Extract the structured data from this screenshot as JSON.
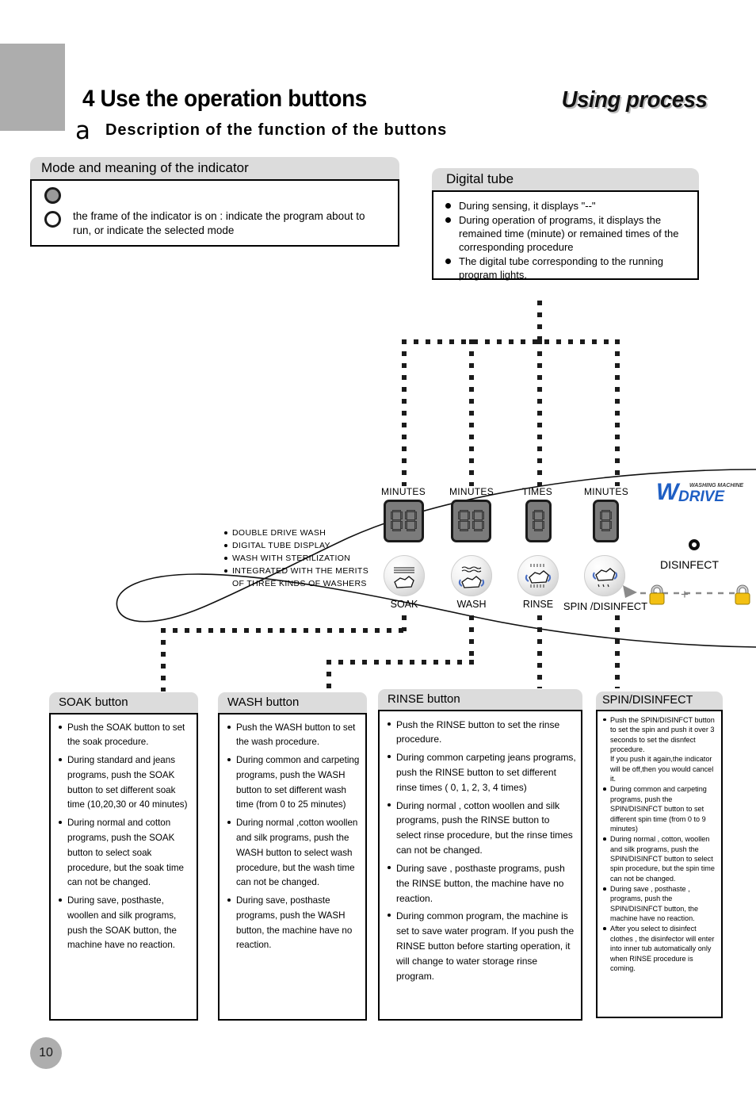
{
  "header": {
    "section_number_title": "4 Use the operation buttons",
    "using_process": "Using process",
    "subsection_letter": "a",
    "subsection_title": "Description of the function of the buttons"
  },
  "mode_panel": {
    "title": "Mode and meaning of the indicator",
    "indicator_filled_note": "",
    "indicator_hollow_note": "the frame of the indicator is on : indicate the program about to run, or indicate the selected mode"
  },
  "digital_tube_panel": {
    "title": "Digital tube",
    "items": [
      "During sensing, it displays \"--\"",
      "During operation of programs, it displays the remained time (minute) or remained times of the corresponding procedure",
      "The digital tube corresponding to the running program lights."
    ]
  },
  "control_panel": {
    "displays": [
      {
        "unit": "MINUTES",
        "digits": 2,
        "value": "88"
      },
      {
        "unit": "MINUTES",
        "digits": 2,
        "value": "88"
      },
      {
        "unit": "TIMES",
        "digits": 1,
        "value": "8"
      },
      {
        "unit": "MINUTES",
        "digits": 1,
        "value": "8"
      }
    ],
    "buttons": [
      {
        "label": "SOAK",
        "icon": "garment-soak-icon"
      },
      {
        "label": "WASH",
        "icon": "garment-wash-icon"
      },
      {
        "label": "RINSE",
        "icon": "garment-rinse-icon"
      },
      {
        "label": "SPIN /DISINFECT",
        "icon": "garment-spin-icon"
      }
    ],
    "features": [
      "DOUBLE DRIVE WASH",
      "DIGITAL TUBE DISPLAY",
      "WASH WITH STERILIZATION",
      "INTEGRATED WITH THE MERITS",
      "OF THREE KINDS OF WASHERS"
    ],
    "disinfect_led_label": "DISINFECT",
    "logo": {
      "top_text": "WASHING MACHINE",
      "main_text": "DRIVE",
      "mark": "W",
      "color": "#1f5fc4"
    },
    "lock_icon_color": "#f3c013"
  },
  "soak_box": {
    "title": "SOAK button",
    "items": [
      "Push the  SOAK  button to set  the soak procedure.",
      "During  standard  and jeans  programs, push the SOAK button to set different soak time (10,20,30 or 40 minutes)",
      "During  normal and cotton  programs, push  the  SOAK  button to select  soak procedure, but the soak time can not be changed.",
      "During save, posthaste, woollen and silk programs, push the  SOAK button, the machine have no reaction."
    ]
  },
  "wash_box": {
    "title": "WASH button",
    "items": [
      "Push the  WASH  button to set  the wash procedure.",
      "During   common   and carpeting programs, push the WASH button to set different wash time (from 0 to 25 minutes)",
      "During normal ,cotton woollen and  silk programs, push  the  WASH button to select  wash procedure, but the wash time can not be changed.",
      "During save, posthaste programs, push the  WASH button, the machine have no reaction."
    ]
  },
  "rinse_box": {
    "title": "RINSE button",
    "items": [
      "Push the  RINSE  button to set the rinse procedure.",
      "During common carpeting jeans programs, push the  RINSE  button  to  set  different rinse  times (  0, 1, 2, 3, 4 times)",
      "During  normal ,  cotton   woollen and  silk  programs, push the  RINSE button to select  rinse  procedure, but the rinse times can not be changed.",
      "During  save , posthaste programs, push the  RINSE  button, the machine have no reaction.",
      "During  common  program, the machine is set to  save water program. If you push the  RINSE  button before starting operation, it will change to  water storage rinse  program."
    ]
  },
  "spin_box": {
    "title": "SPIN/DISINFECT",
    "items": [
      {
        "main": "Push the  SPIN/DISINFCT button to set the spin and push it over 3 seconds to set the disnfect procedure.",
        "cont": "If you push it again,the indicator will be off,then you would cancel it."
      },
      {
        "main": "During  common  and carpeting  programs, push the SPIN/DISINFCT button  to set  different spin time (from 0 to 9 minutes)",
        "cont": ""
      },
      {
        "main": "During  normal , cotton,  woollen  and  silk programs, push the SPIN/DISINFCT button to select spin procedure, but the spin time can not be changed.",
        "cont": ""
      },
      {
        "main": "During  save , posthaste , programs, push the SPIN/DISINFCT button, the  machine have no reaction.",
        "cont": ""
      },
      {
        "main": "After you select to disinfect clothes , the disinfector will enter into inner tub automatically only when RINSE procedure is coming.",
        "cont": ""
      }
    ]
  },
  "footer": {
    "page_number": "10"
  }
}
